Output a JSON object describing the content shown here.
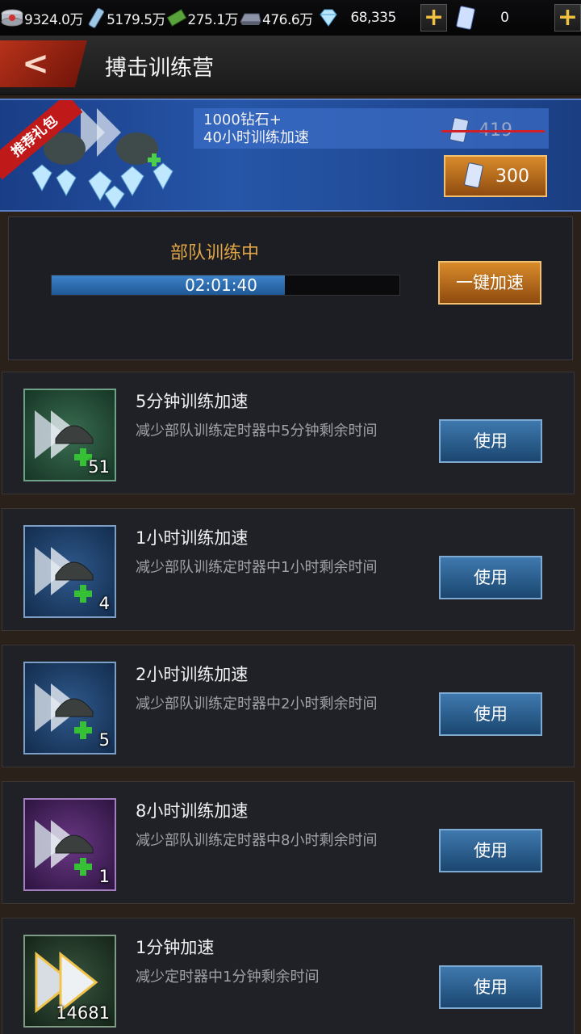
{
  "resources": {
    "silver": "9324.0万",
    "fuel": "5179.5万",
    "cash": "275.1万",
    "steel": "476.6万",
    "diamonds": "68,335",
    "cards": "0"
  },
  "header": {
    "back_label": "<",
    "title": "搏击训练营"
  },
  "gift": {
    "tag": "推荐礼包",
    "line1": "1000钻石+",
    "line2": "40小时训练加速",
    "old_price": "419",
    "price": "300"
  },
  "training": {
    "title": "部队训练中",
    "timer": "02:01:40",
    "progress": 0.67,
    "speedup_label": "一键加速"
  },
  "items": [
    {
      "title": "5分钟训练加速",
      "desc": "减少部队训练定时器中5分钟剩余时间",
      "count": "51",
      "button": "使用",
      "rarity": "green"
    },
    {
      "title": "1小时训练加速",
      "desc": "减少部队训练定时器中1小时剩余时间",
      "count": "4",
      "button": "使用",
      "rarity": "blue"
    },
    {
      "title": "2小时训练加速",
      "desc": "减少部队训练定时器中2小时剩余时间",
      "count": "5",
      "button": "使用",
      "rarity": "blue"
    },
    {
      "title": "8小时训练加速",
      "desc": "减少部队训练定时器中8小时剩余时间",
      "count": "1",
      "button": "使用",
      "rarity": "purple"
    },
    {
      "title": "1分钟加速",
      "desc": "减少定时器中1分钟剩余时间",
      "count": "14681",
      "button": "使用",
      "rarity": "gold"
    }
  ]
}
